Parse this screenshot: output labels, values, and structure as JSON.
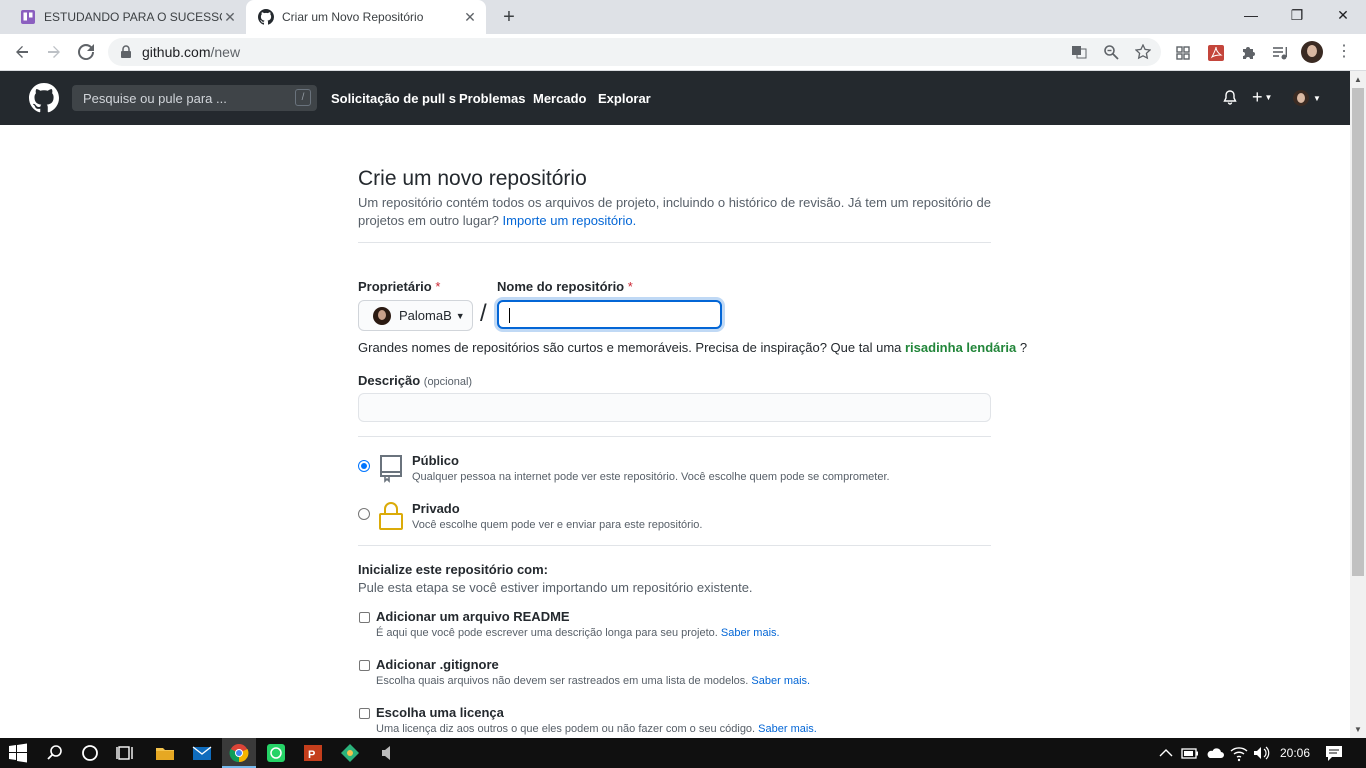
{
  "browser": {
    "tabs": [
      {
        "title": "ESTUDANDO PARA O SUCESSO |",
        "active": false
      },
      {
        "title": "Criar um Novo Repositório",
        "active": true
      }
    ],
    "url_host": "github.com",
    "url_path": "/new"
  },
  "header": {
    "search_placeholder": "Pesquise ou pule para ...",
    "search_shortcut": "/",
    "nav": [
      "Solicitação de pull s",
      "Problemas",
      "Mercado",
      "Explorar"
    ]
  },
  "page": {
    "title": "Crie um novo repositório",
    "subtitle": "Um repositório contém todos os arquivos de projeto, incluindo o histórico de revisão. Já tem um repositório de projetos em outro lugar?",
    "import_link": "Importe um repositório.",
    "owner_label": "Proprietário",
    "repo_name_label": "Nome do repositório",
    "required_mark": "*",
    "owner_value": "PalomaB",
    "separator": "/",
    "hint_text": "Grandes nomes de repositórios são curtos e memoráveis. Precisa de inspiração? Que tal uma",
    "hint_suggestion": "risadinha lendária",
    "hint_end": "?",
    "description_label": "Descrição",
    "description_optional": "(opcional)",
    "visibility": [
      {
        "title": "Público",
        "desc": "Qualquer pessoa na internet pode ver este repositório. Você escolhe quem pode se comprometer.",
        "checked": true
      },
      {
        "title": "Privado",
        "desc": "Você escolhe quem pode ver e enviar para este repositório.",
        "checked": false
      }
    ],
    "init_title": "Inicialize este repositório com:",
    "init_sub": "Pule esta etapa se você estiver importando um repositório existente.",
    "init_options": [
      {
        "title": "Adicionar um arquivo README",
        "desc": "É aqui que você pode escrever uma descrição longa para seu projeto.",
        "link": "Saber mais."
      },
      {
        "title": "Adicionar .gitignore",
        "desc": "Escolha quais arquivos não devem ser rastreados em uma lista de modelos.",
        "link": "Saber mais."
      },
      {
        "title": "Escolha uma licença",
        "desc": "Uma licença diz aos outros o que eles podem ou não fazer com o seu código.",
        "link": "Saber mais."
      }
    ]
  },
  "taskbar": {
    "time": "20:06"
  }
}
